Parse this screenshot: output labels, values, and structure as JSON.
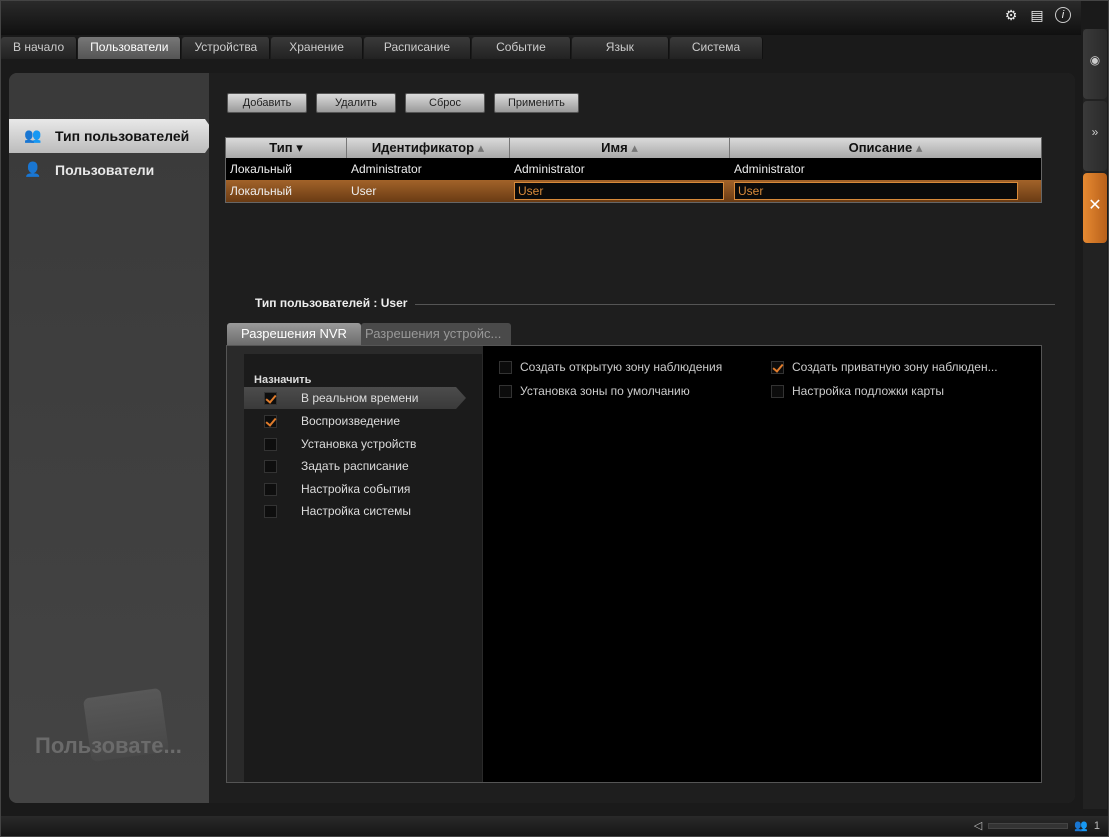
{
  "top_icons": [
    "gear-icon",
    "document-icon",
    "info-icon"
  ],
  "tabs": [
    {
      "label": "В начало"
    },
    {
      "label": "Пользователи",
      "active": true
    },
    {
      "label": "Устройства"
    },
    {
      "label": "Хранение"
    },
    {
      "label": "Расписание"
    },
    {
      "label": "Событие"
    },
    {
      "label": "Язык"
    },
    {
      "label": "Система"
    }
  ],
  "sidebar": {
    "items": [
      {
        "label": "Тип пользователей",
        "icon": "users-group-icon",
        "active": true
      },
      {
        "label": "Пользователи",
        "icon": "user-icon"
      }
    ],
    "watermark": "Пользовате..."
  },
  "toolbar": {
    "add_label": "Добавить",
    "delete_label": "Удалить",
    "reset_label": "Сброс",
    "apply_label": "Применить"
  },
  "table": {
    "columns": [
      "Тип",
      "Идентификатор",
      "Имя",
      "Описание"
    ],
    "rows": [
      [
        "Локальный",
        "Administrator",
        "Administrator",
        "Administrator"
      ],
      [
        "Локальный",
        "User",
        "User",
        "User"
      ]
    ]
  },
  "section": {
    "title": "Тип пользователей : User"
  },
  "subtabs": [
    "Разрешения NVR",
    "Разрешения устройс..."
  ],
  "permissions": {
    "assign_label": "Назначить",
    "items": [
      {
        "label": "В реальном времени",
        "checked": true,
        "active": true
      },
      {
        "label": "Воспроизведение",
        "checked": true
      },
      {
        "label": "Установка устройств",
        "checked": false
      },
      {
        "label": "Задать расписание",
        "checked": false
      },
      {
        "label": "Настройка события",
        "checked": false
      },
      {
        "label": "Настройка системы",
        "checked": false
      }
    ],
    "right": [
      {
        "label": "Создать открытую зону наблюдения",
        "checked": false
      },
      {
        "label": "Создать приватную зону наблюден...",
        "checked": true
      },
      {
        "label": "Установка зоны по умолчанию",
        "checked": false
      },
      {
        "label": "Настройка подложки карты",
        "checked": false
      }
    ]
  },
  "status": {
    "user_count": "1"
  },
  "colors": {
    "accent": "#e07c2c",
    "selected_row": "#8a4f1e"
  }
}
